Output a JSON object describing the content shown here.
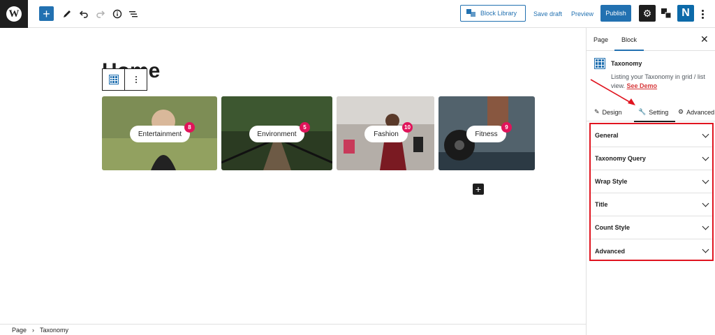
{
  "topbar": {
    "block_library": "Block Library",
    "save_draft": "Save draft",
    "preview": "Preview",
    "publish": "Publish",
    "plugin_letter": "N"
  },
  "editor": {
    "page_title": "Home",
    "cards": [
      {
        "name": "Entertainment",
        "count": "8",
        "bg": "#7d8d55"
      },
      {
        "name": "Environment",
        "count": "5",
        "bg": "#2b3b22"
      },
      {
        "name": "Fashion",
        "count": "10",
        "bg": "#b4aea8"
      },
      {
        "name": "Fitness",
        "count": "9",
        "bg": "#52626c"
      }
    ]
  },
  "sidebar": {
    "tabs": [
      "Page",
      "Block"
    ],
    "block": {
      "name": "Taxonomy",
      "description": "Listing your Taxonomy in grid / list view.",
      "demo_link": "See Demo"
    },
    "subtabs": [
      "Design",
      "Setting",
      "Advanced"
    ],
    "panels": [
      "General",
      "Taxonomy Query",
      "Wrap Style",
      "Title",
      "Count Style",
      "Advanced"
    ]
  },
  "breadcrumb": [
    "Page",
    "Taxonomy"
  ],
  "colors": {
    "accent": "#2271b1",
    "badge": "#e0145a",
    "highlight": "#e0141f"
  }
}
